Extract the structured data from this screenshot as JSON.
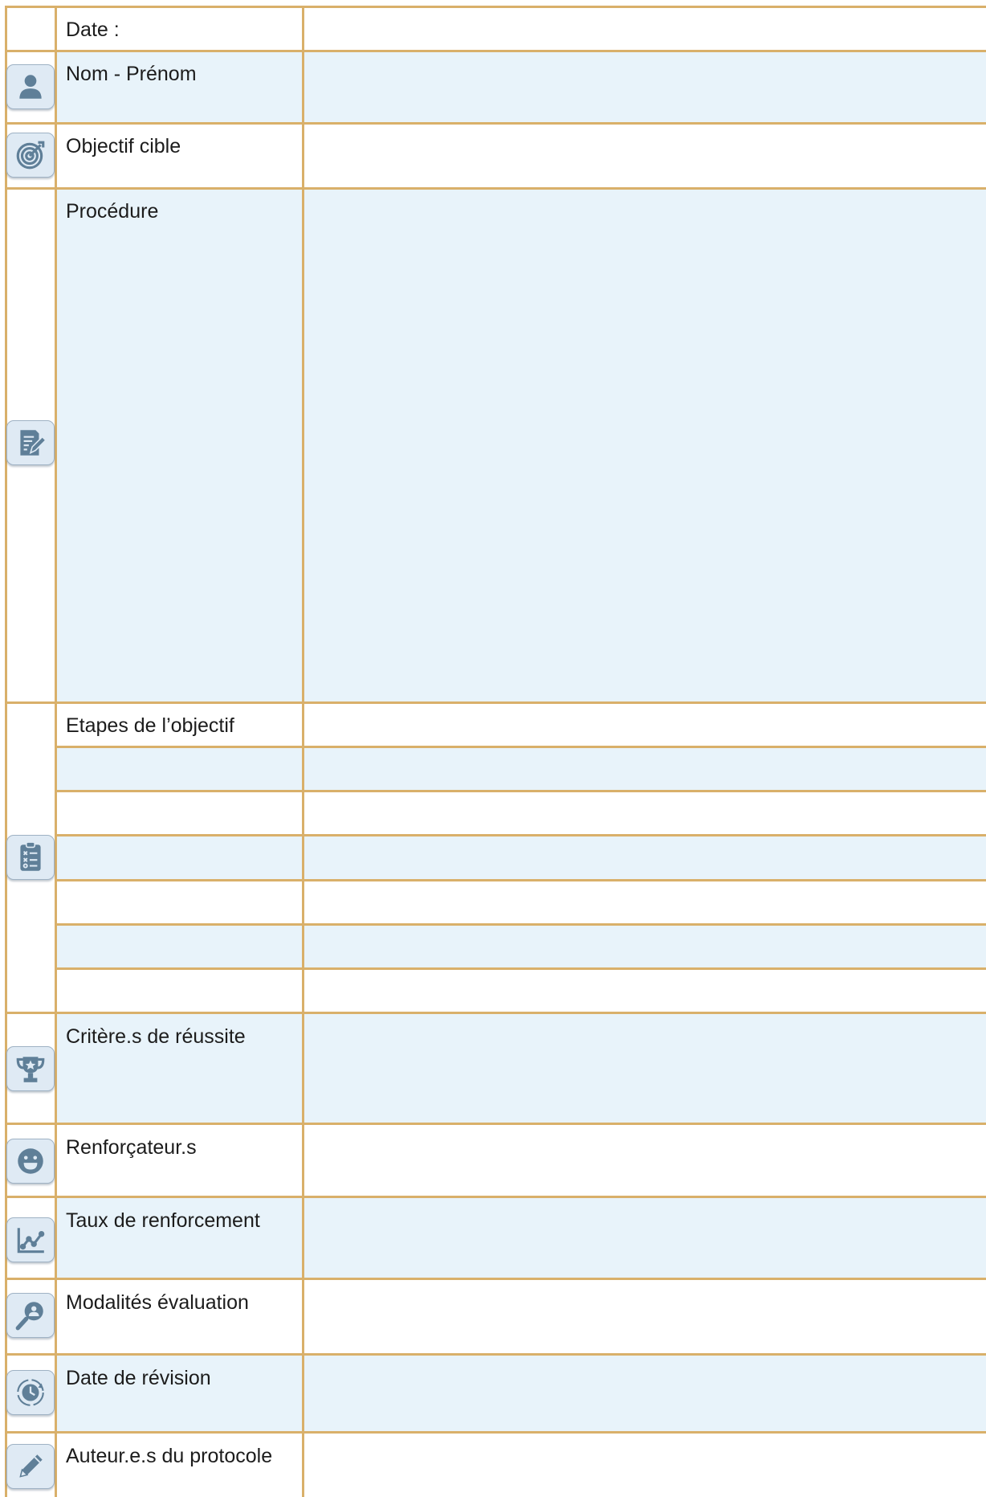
{
  "form": {
    "date_label": "Date :",
    "nom_prenom_label": "Nom - Prénom",
    "objectif_cible_label": "Objectif cible",
    "procedure_label": "Procédure",
    "etapes_label": "Etapes de l’objectif",
    "criteres_label": "Critère.s de réussite",
    "renforcateurs_label": "Renforçateur.s",
    "taux_label": "Taux de renforcement",
    "modalites_label": "Modalités évaluation",
    "date_revision_label": "Date de révision",
    "auteurs_label": "Auteur.e.s du protocole"
  },
  "icons": {
    "nom_prenom": "person-icon",
    "objectif_cible": "target-icon",
    "procedure": "document-edit-icon",
    "etapes": "checklist-icon",
    "criteres": "trophy-icon",
    "renforcateurs": "smiley-icon",
    "taux": "line-chart-icon",
    "modalites": "search-person-icon",
    "date_revision": "clock-cycle-icon",
    "auteurs": "pencil-icon"
  },
  "colors": {
    "border": "#d9b06a",
    "row_tint": "#e8f3fa",
    "icon_fill": "#5f7f98",
    "icon_bg": "#dfeaf4"
  }
}
